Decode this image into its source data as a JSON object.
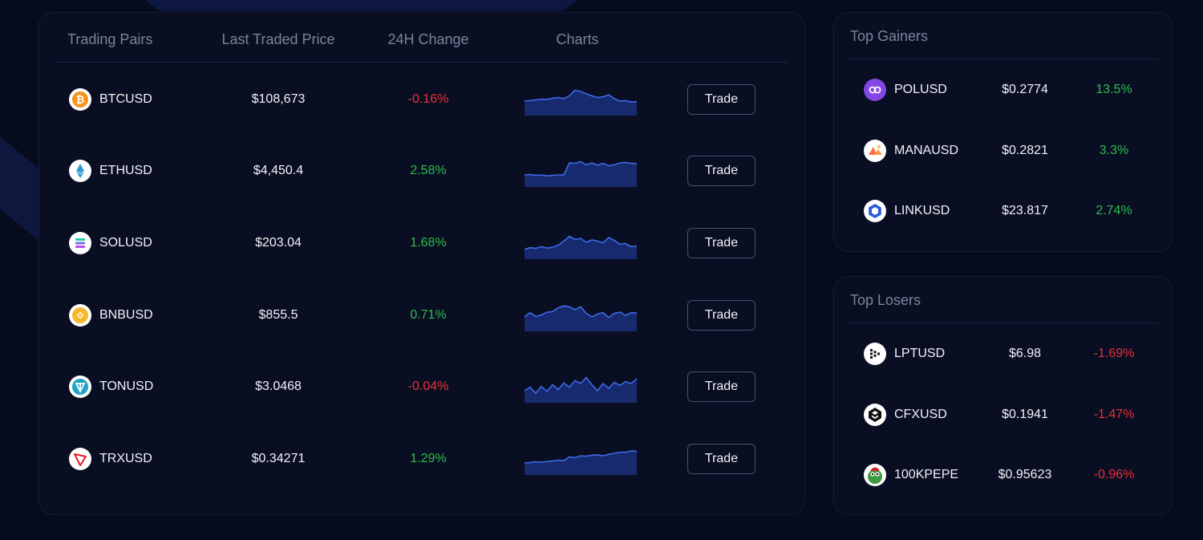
{
  "table": {
    "headers": {
      "pair": "Trading Pairs",
      "price": "Last Traded Price",
      "change": "24H Change",
      "charts": "Charts"
    },
    "rows": [
      {
        "pair": "BTCUSD",
        "price": "$108,673",
        "change": "-0.16%",
        "direction": "down",
        "icon": "bitcoin-icon",
        "trade": "Trade",
        "spark": [
          0.4,
          0.42,
          0.45,
          0.48,
          0.47,
          0.52,
          0.55,
          0.5,
          0.62,
          0.85,
          0.8,
          0.7,
          0.62,
          0.55,
          0.58,
          0.66,
          0.5,
          0.4,
          0.42,
          0.36,
          0.38
        ]
      },
      {
        "pair": "ETHUSD",
        "price": "$4,450.4",
        "change": "2.58%",
        "direction": "up",
        "icon": "ethereum-icon",
        "trade": "Trade",
        "spark": [
          0.3,
          0.32,
          0.28,
          0.3,
          0.26,
          0.28,
          0.3,
          0.3,
          0.8,
          0.78,
          0.85,
          0.72,
          0.8,
          0.7,
          0.78,
          0.68,
          0.72,
          0.8,
          0.82,
          0.78,
          0.76
        ]
      },
      {
        "pair": "SOLUSD",
        "price": "$203.04",
        "change": "1.68%",
        "direction": "up",
        "icon": "solana-icon",
        "trade": "Trade",
        "spark": [
          0.2,
          0.28,
          0.25,
          0.32,
          0.26,
          0.3,
          0.38,
          0.55,
          0.75,
          0.62,
          0.66,
          0.5,
          0.6,
          0.55,
          0.48,
          0.7,
          0.58,
          0.42,
          0.45,
          0.32,
          0.34
        ]
      },
      {
        "pair": "BNBUSD",
        "price": "$855.5",
        "change": "0.71%",
        "direction": "up",
        "icon": "bnb-icon",
        "trade": "Trade",
        "spark": [
          0.4,
          0.58,
          0.42,
          0.48,
          0.6,
          0.62,
          0.78,
          0.86,
          0.82,
          0.7,
          0.82,
          0.55,
          0.4,
          0.52,
          0.58,
          0.38,
          0.55,
          0.6,
          0.46,
          0.58,
          0.56
        ]
      },
      {
        "pair": "TONUSD",
        "price": "$3.0468",
        "change": "-0.04%",
        "direction": "down",
        "icon": "toncoin-icon",
        "trade": "Trade",
        "spark": [
          0.3,
          0.45,
          0.2,
          0.48,
          0.28,
          0.55,
          0.35,
          0.62,
          0.45,
          0.72,
          0.6,
          0.85,
          0.55,
          0.3,
          0.6,
          0.4,
          0.65,
          0.52,
          0.68,
          0.6,
          0.8
        ]
      },
      {
        "pair": "TRXUSD",
        "price": "$0.34271",
        "change": "1.29%",
        "direction": "up",
        "icon": "tron-icon",
        "trade": "Trade",
        "spark": [
          0.3,
          0.32,
          0.35,
          0.33,
          0.36,
          0.38,
          0.42,
          0.4,
          0.55,
          0.52,
          0.6,
          0.58,
          0.62,
          0.64,
          0.6,
          0.66,
          0.7,
          0.75,
          0.74,
          0.8,
          0.78
        ]
      }
    ]
  },
  "gainers": {
    "title": "Top Gainers",
    "rows": [
      {
        "pair": "POLUSD",
        "price": "$0.2774",
        "change": "13.5%",
        "direction": "up",
        "icon": "polygon-icon"
      },
      {
        "pair": "MANAUSD",
        "price": "$0.2821",
        "change": "3.3%",
        "direction": "up",
        "icon": "decentraland-icon"
      },
      {
        "pair": "LINKUSD",
        "price": "$23.817",
        "change": "2.74%",
        "direction": "up",
        "icon": "chainlink-icon"
      }
    ]
  },
  "losers": {
    "title": "Top Losers",
    "rows": [
      {
        "pair": "LPTUSD",
        "price": "$6.98",
        "change": "-1.69%",
        "direction": "down",
        "icon": "livepeer-icon"
      },
      {
        "pair": "CFXUSD",
        "price": "$0.1941",
        "change": "-1.47%",
        "direction": "down",
        "icon": "conflux-icon"
      },
      {
        "pair": "100KPEPE",
        "price": "$0.95623",
        "change": "-0.96%",
        "direction": "down",
        "icon": "pepe-icon"
      }
    ]
  },
  "colors": {
    "up": "#2ebd4e",
    "down": "#e8313a",
    "spark_line": "#3c6ae8",
    "spark_fill": "#182a6e"
  }
}
